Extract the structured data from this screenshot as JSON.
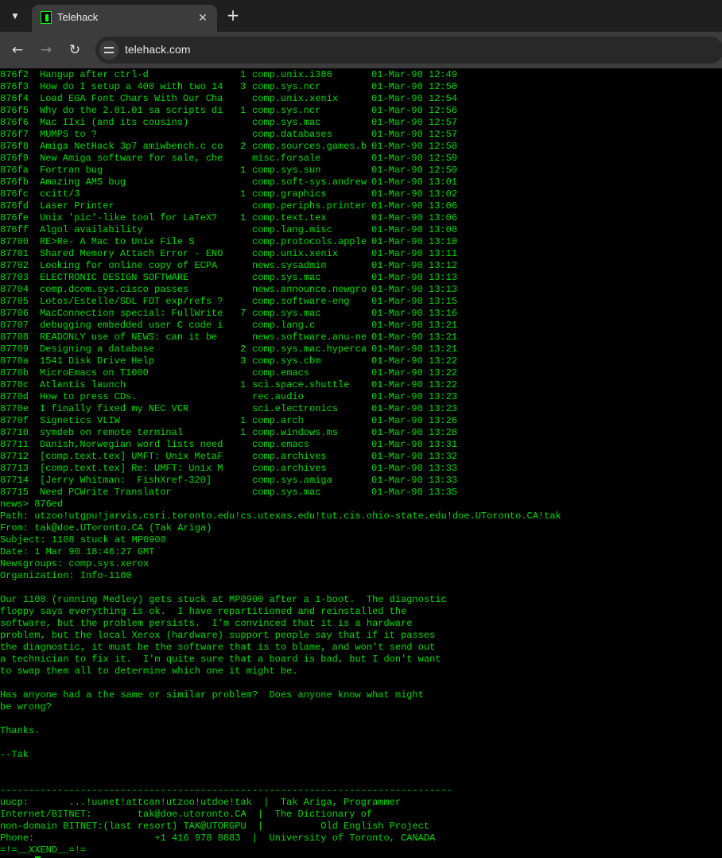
{
  "browser": {
    "tab_title": "Telehack",
    "url": "telehack.com",
    "icons": {
      "tab_menu": "chevron-down-icon",
      "close": "close-icon",
      "new_tab": "plus-icon",
      "back": "arrow-left-icon",
      "forward": "arrow-right-icon",
      "reload": "reload-icon",
      "site_info": "tune-icon"
    }
  },
  "terminal": {
    "colors": {
      "text": "#00dd00",
      "background": "#000000"
    },
    "listing": [
      {
        "id": "876f2",
        "subject": "Hangup after ctrl-d",
        "count": "1",
        "group": "comp.unix.i386",
        "date": "01-Mar-90 12:49"
      },
      {
        "id": "876f3",
        "subject": "How do I setup a 400 with two 14",
        "count": "3",
        "group": "comp.sys.ncr",
        "date": "01-Mar-90 12:50"
      },
      {
        "id": "876f4",
        "subject": "Load EGA Font Chars With Our Cha",
        "count": "",
        "group": "comp.unix.xenix",
        "date": "01-Mar-90 12:54"
      },
      {
        "id": "876f5",
        "subject": "Why do the 2.01.01 sa scripts di",
        "count": "1",
        "group": "comp.sys.ncr",
        "date": "01-Mar-90 12:56"
      },
      {
        "id": "876f6",
        "subject": "Mac IIxi (and its cousins)",
        "count": "",
        "group": "comp.sys.mac",
        "date": "01-Mar-90 12:57"
      },
      {
        "id": "876f7",
        "subject": "MUMPS to ?",
        "count": "",
        "group": "comp.databases",
        "date": "01-Mar-90 12:57"
      },
      {
        "id": "876f8",
        "subject": "Amiga NetHack 3p7 amiwbench.c co",
        "count": "2",
        "group": "comp.sources.games.b",
        "date": "01-Mar-90 12:58"
      },
      {
        "id": "876f9",
        "subject": "New Amiga software for sale, che",
        "count": "",
        "group": "misc.forsale",
        "date": "01-Mar-90 12:59"
      },
      {
        "id": "876fa",
        "subject": "Fortran bug",
        "count": "1",
        "group": "comp.sys.sun",
        "date": "01-Mar-90 12:59"
      },
      {
        "id": "876fb",
        "subject": "Amazing AMS bug",
        "count": "",
        "group": "comp.soft-sys.andrew",
        "date": "01-Mar-90 13:01"
      },
      {
        "id": "876fc",
        "subject": "ccitt/3",
        "count": "1",
        "group": "comp.graphics",
        "date": "01-Mar-90 13:02"
      },
      {
        "id": "876fd",
        "subject": "Laser Printer",
        "count": "",
        "group": "comp.periphs.printer",
        "date": "01-Mar-90 13:06"
      },
      {
        "id": "876fe",
        "subject": "Unix 'pic'-like tool for LaTeX?",
        "count": "1",
        "group": "comp.text.tex",
        "date": "01-Mar-90 13:06"
      },
      {
        "id": "876ff",
        "subject": "Algol availability",
        "count": "",
        "group": "comp.lang.misc",
        "date": "01-Mar-90 13:08"
      },
      {
        "id": "87700",
        "subject": "RE>Re- A Mac to Unix File S",
        "count": "",
        "group": "comp.protocols.apple",
        "date": "01-Mar-90 13:10"
      },
      {
        "id": "87701",
        "subject": "Shared Memory Attach Error - ENO",
        "count": "",
        "group": "comp.unix.xenix",
        "date": "01-Mar-90 13:11"
      },
      {
        "id": "87702",
        "subject": "Looking for online copy of ECPA",
        "count": "",
        "group": "news.sysadmin",
        "date": "01-Mar-90 13:12"
      },
      {
        "id": "87703",
        "subject": "ELECTRONIC DESIGN SOFTWARE",
        "count": "",
        "group": "comp.sys.mac",
        "date": "01-Mar-90 13:13"
      },
      {
        "id": "87704",
        "subject": "comp.dcom.sys.cisco passes",
        "count": "",
        "group": "news.announce.newgro",
        "date": "01-Mar-90 13:13"
      },
      {
        "id": "87705",
        "subject": "Lotos/Estelle/SDL FDT exp/refs ?",
        "count": "",
        "group": "comp.software-eng",
        "date": "01-Mar-90 13:15"
      },
      {
        "id": "87706",
        "subject": "MacConnection special: FullWrite",
        "count": "7",
        "group": "comp.sys.mac",
        "date": "01-Mar-90 13:16"
      },
      {
        "id": "87707",
        "subject": "debugging embedded user C code i",
        "count": "",
        "group": "comp.lang.c",
        "date": "01-Mar-90 13:21"
      },
      {
        "id": "87708",
        "subject": "READONLY use of NEWS: can it be",
        "count": "",
        "group": "news.software.anu-ne",
        "date": "01-Mar-90 13:21"
      },
      {
        "id": "87709",
        "subject": "Designing a database",
        "count": "2",
        "group": "comp.sys.mac.hyperca",
        "date": "01-Mar-90 13:21"
      },
      {
        "id": "8770a",
        "subject": "1541 Disk Drive Help",
        "count": "3",
        "group": "comp.sys.cbm",
        "date": "01-Mar-90 13:22"
      },
      {
        "id": "8770b",
        "subject": "MicroEmacs on T1000",
        "count": "",
        "group": "comp.emacs",
        "date": "01-Mar-90 13:22"
      },
      {
        "id": "8770c",
        "subject": "Atlantis launch",
        "count": "1",
        "group": "sci.space.shuttle",
        "date": "01-Mar-90 13:22"
      },
      {
        "id": "8770d",
        "subject": "How to press CDs.",
        "count": "",
        "group": "rec.audio",
        "date": "01-Mar-90 13:23"
      },
      {
        "id": "8770e",
        "subject": "I finally fixed my NEC VCR",
        "count": "",
        "group": "sci.electronics",
        "date": "01-Mar-90 13:23"
      },
      {
        "id": "8770f",
        "subject": "Signetics VLIW",
        "count": "1",
        "group": "comp.arch",
        "date": "01-Mar-90 13:26"
      },
      {
        "id": "87710",
        "subject": "symdeb on remote terminal",
        "count": "1",
        "group": "comp.windows.ms",
        "date": "01-Mar-90 13:28"
      },
      {
        "id": "87711",
        "subject": "Danish,Norwegian word lists need",
        "count": "",
        "group": "comp.emacs",
        "date": "01-Mar-90 13:31"
      },
      {
        "id": "87712",
        "subject": "[comp.text.tex] UMFT: Unix MetaF",
        "count": "",
        "group": "comp.archives",
        "date": "01-Mar-90 13:32"
      },
      {
        "id": "87713",
        "subject": "[comp.text.tex] Re: UMFT: Unix M",
        "count": "",
        "group": "comp.archives",
        "date": "01-Mar-90 13:33"
      },
      {
        "id": "87714",
        "subject": "[Jerry Whitman:  FishXref-320]",
        "count": "",
        "group": "comp.sys.amiga",
        "date": "01-Mar-90 13:33"
      },
      {
        "id": "87715",
        "subject": "Need PCWrite Translator",
        "count": "",
        "group": "comp.sys.mac",
        "date": "01-Mar-90 13:35"
      }
    ],
    "article_lines": [
      "news> 876ed",
      "Path: utzoo!utgpu!jarvis.csri.toronto.edu!cs.utexas.edu!tut.cis.ohio-state.edu!doe.UToronto.CA!tak",
      "From: tak@doe.UToronto.CA (Tak Ariga)",
      "Subject: 1108 stuck at MP0900",
      "Date: 1 Mar 90 18:46:27 GMT",
      "Newsgroups: comp.sys.xerox",
      "Organization: Info-1100",
      "",
      "Our 1108 (running Medley) gets stuck at MP0900 after a 1-boot.  The diagnostic",
      "floppy says everything is ok.  I have repartitioned and reinstalled the",
      "software, but the problem persists.  I'm convinced that it is a hardware",
      "problem, but the local Xerox (hardware) support people say that if it passes",
      "the diagnostic, it must be the software that is to blame, and won't send out",
      "a technician to fix it.  I'm quite sure that a board is bad, but I don't want",
      "to swap them all to determine which one it might be.",
      "",
      "Has anyone had a the same or similar problem?  Does anyone know what might",
      "be wrong?",
      "",
      "Thanks.",
      "",
      "--Tak",
      "",
      "",
      "-------------------------------------------------------------------------------",
      "uucp:       ...!uunet!attcan!utzoo!utdoe!tak  |  Tak Ariga, Programmer",
      "Internet/BITNET:        tak@doe.utoronto.CA  |  The Dictionary of",
      "non-domain BITNET:(last resort) TAK@UTORGPU  |          Old English Project",
      "Phone:                     +1 416 978 8883  |  University of Toronto, CANADA",
      "=!=__XXEND__=!="
    ],
    "prompt": "news> "
  }
}
